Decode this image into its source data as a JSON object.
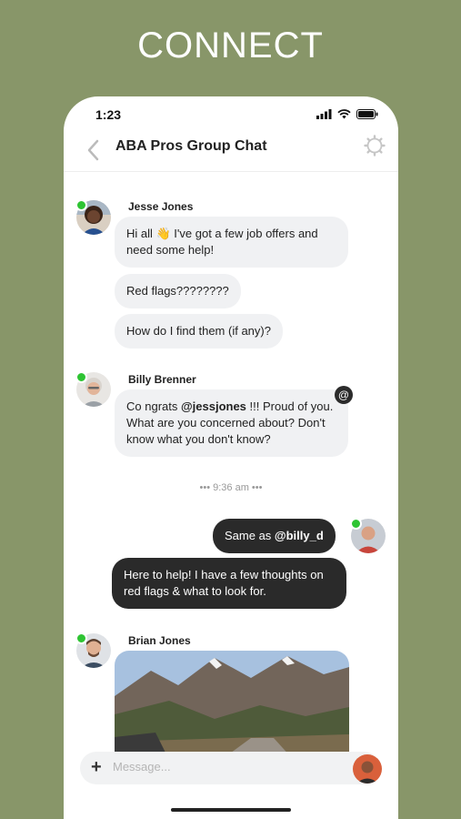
{
  "headline": "CONNECT",
  "status_bar": {
    "time": "1:23"
  },
  "header": {
    "title": "ABA Pros Group Chat"
  },
  "messages": [
    {
      "sender": "Jesse Jones",
      "bubbles": [
        "Hi all 👋 I've got a few job offers and need some help!",
        "Red flags????????",
        "How do I find them (if any)?"
      ]
    },
    {
      "sender": "Billy Brenner",
      "text_pre": "Co ngrats ",
      "mention": "@jessjones",
      "text_post": " !!! Proud of you. What are you concerned about? Don't know what you don't know?",
      "badge": "@"
    },
    {
      "timestamp": "••• 9:36 am •••"
    },
    {
      "self": true,
      "text_pre": "Same as ",
      "mention": "@billy_d"
    },
    {
      "self": true,
      "text": "Here to help! I have a few thoughts on red flags & what to look for."
    },
    {
      "sender": "Brian Jones"
    }
  ],
  "composer": {
    "placeholder": "Message..."
  },
  "colors": {
    "background": "#889669",
    "online": "#2ec433",
    "dark_bubble": "#2a2a2a",
    "light_bubble": "#f0f1f3"
  }
}
